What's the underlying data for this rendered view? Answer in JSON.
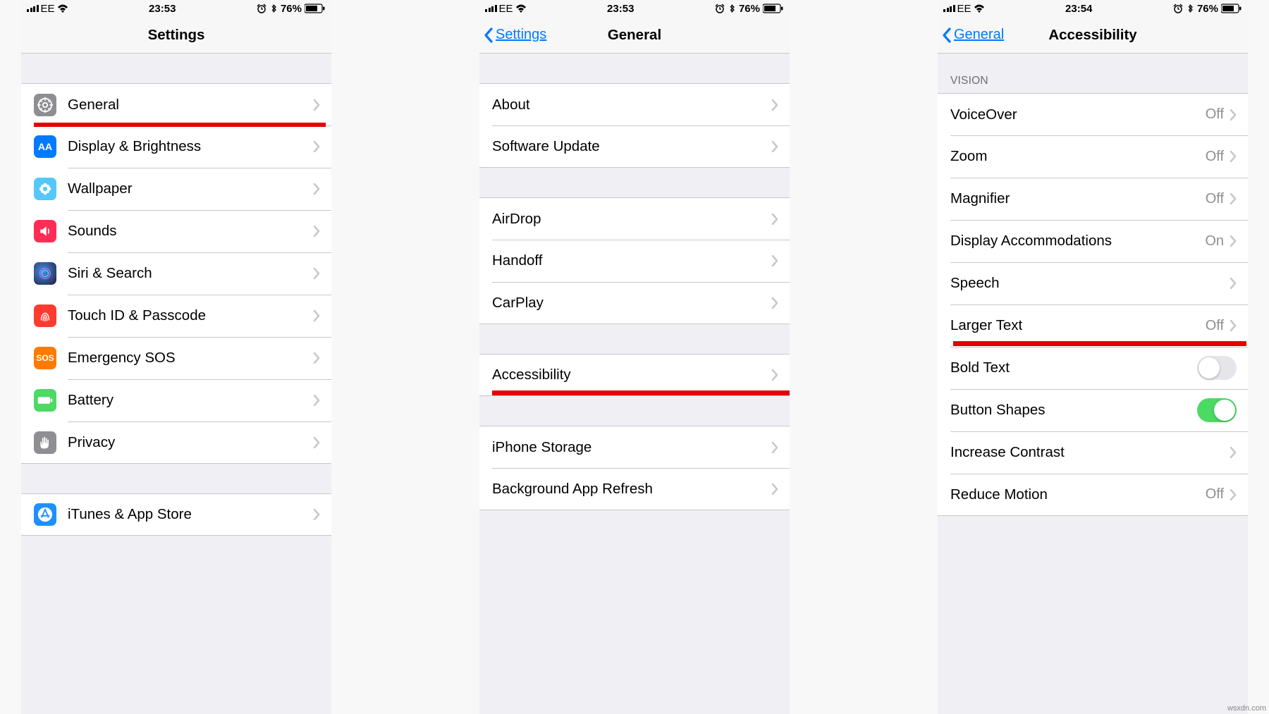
{
  "status": {
    "carrier": "EE",
    "time_a": "23:53",
    "time_b": "23:54",
    "battery": "76%"
  },
  "watermark": "wsxdn.com",
  "p1": {
    "title": "Settings",
    "items": [
      {
        "label": "General",
        "icon": "gear",
        "color": "#8e8e93",
        "hl": true
      },
      {
        "label": "Display & Brightness",
        "icon": "aa",
        "color": "#007aff"
      },
      {
        "label": "Wallpaper",
        "icon": "flower",
        "color": "#54c7fc"
      },
      {
        "label": "Sounds",
        "icon": "speaker",
        "color": "#ff2d55"
      },
      {
        "label": "Siri & Search",
        "icon": "siri",
        "color": "#1c1c1e"
      },
      {
        "label": "Touch ID & Passcode",
        "icon": "touchid",
        "color": "#ff3b30"
      },
      {
        "label": "Emergency SOS",
        "icon": "sos",
        "color": "#ff7a00"
      },
      {
        "label": "Battery",
        "icon": "batt",
        "color": "#4cd964"
      },
      {
        "label": "Privacy",
        "icon": "hand",
        "color": "#8e8e93"
      }
    ],
    "itunes": "iTunes & App Store"
  },
  "p2": {
    "back": "Settings",
    "title": "General",
    "g1": [
      "About",
      "Software Update"
    ],
    "g2": [
      "AirDrop",
      "Handoff",
      "CarPlay"
    ],
    "g3": [
      "Accessibility"
    ],
    "g4": [
      "iPhone Storage",
      "Background App Refresh"
    ]
  },
  "p3": {
    "back": "General",
    "title": "Accessibility",
    "section": "VISION",
    "rows": [
      {
        "label": "VoiceOver",
        "detail": "Off"
      },
      {
        "label": "Zoom",
        "detail": "Off"
      },
      {
        "label": "Magnifier",
        "detail": "Off"
      },
      {
        "label": "Display Accommodations",
        "detail": "On"
      },
      {
        "label": "Speech"
      },
      {
        "label": "Larger Text",
        "detail": "Off",
        "hl": true
      },
      {
        "label": "Bold Text",
        "toggle": "off"
      },
      {
        "label": "Button Shapes",
        "toggle": "on"
      },
      {
        "label": "Increase Contrast"
      },
      {
        "label": "Reduce Motion",
        "detail": "Off"
      }
    ]
  }
}
